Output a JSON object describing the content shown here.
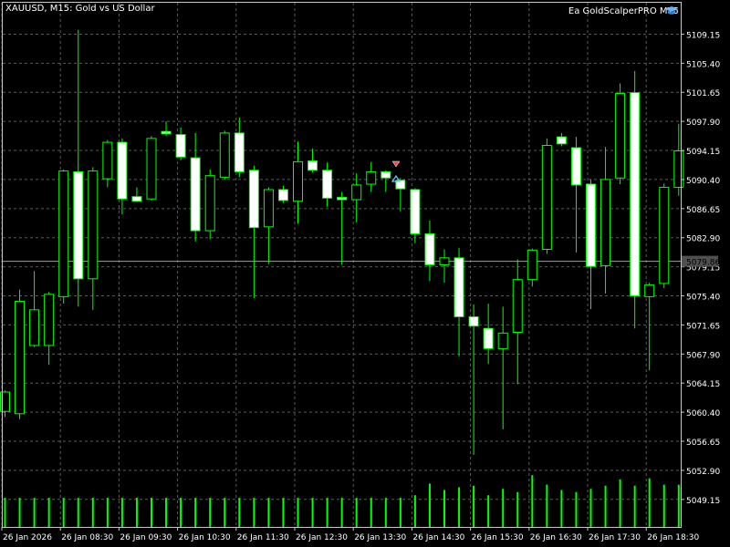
{
  "window": {
    "title": "XAUUSD, M15:  Gold vs US Dollar",
    "expert_advisor": "Ea GoldScalperPRO MT5",
    "expert_advisor_icon": "graduation-cap-icon"
  },
  "colors": {
    "background": "#000000",
    "grid": "#5a5a5a",
    "frame": "#c8c8c8",
    "bull_body": "#000000",
    "bear_body": "#ffffff",
    "candle_outline": "#00ff00",
    "wick": "#00ff00",
    "volume": "#00ff00",
    "text": "#ffffff",
    "price_line": "#a0a0a0",
    "sell_marker": "#ff4444",
    "buy_marker": "#66ccff"
  },
  "chart_data": {
    "type": "candlestick",
    "symbol": "XAUUSD",
    "timeframe": "M15",
    "current_price": 5079.86,
    "y_ticks": [
      5109.15,
      5105.4,
      5101.65,
      5097.9,
      5094.15,
      5090.4,
      5086.65,
      5082.9,
      5079.15,
      5075.4,
      5071.65,
      5067.9,
      5064.15,
      5060.4,
      5056.65,
      5052.9,
      5049.15
    ],
    "x_ticks": [
      "26 Jan 2026",
      "26 Jan 08:30",
      "26 Jan 09:30",
      "26 Jan 10:30",
      "26 Jan 11:30",
      "26 Jan 12:30",
      "26 Jan 13:30",
      "26 Jan 14:30",
      "26 Jan 15:30",
      "26 Jan 16:30",
      "26 Jan 17:30",
      "26 Jan 18:30"
    ],
    "ylim": [
      5045.6,
      5113.2
    ],
    "grid": true,
    "candles": [
      {
        "o": 5060.5,
        "h": 5063.2,
        "l": 5059.8,
        "c": 5063.0
      },
      {
        "o": 5060.2,
        "h": 5076.2,
        "l": 5059.5,
        "c": 5074.7
      },
      {
        "o": 5069.0,
        "h": 5078.6,
        "l": 5068.8,
        "c": 5073.6
      },
      {
        "o": 5069.0,
        "h": 5075.9,
        "l": 5066.5,
        "c": 5075.6
      },
      {
        "o": 5075.3,
        "h": 5091.7,
        "l": 5074.4,
        "c": 5091.5
      },
      {
        "o": 5091.4,
        "h": 5109.7,
        "l": 5074.0,
        "c": 5077.6
      },
      {
        "o": 5077.6,
        "h": 5092.0,
        "l": 5073.6,
        "c": 5091.5
      },
      {
        "o": 5090.5,
        "h": 5095.5,
        "l": 5089.4,
        "c": 5095.2
      },
      {
        "o": 5095.2,
        "h": 5095.7,
        "l": 5085.9,
        "c": 5087.9
      },
      {
        "o": 5088.2,
        "h": 5089.4,
        "l": 5087.5,
        "c": 5087.6
      },
      {
        "o": 5087.9,
        "h": 5096.0,
        "l": 5087.7,
        "c": 5095.7
      },
      {
        "o": 5096.6,
        "h": 5097.9,
        "l": 5096.0,
        "c": 5096.3
      },
      {
        "o": 5096.2,
        "h": 5097.1,
        "l": 5092.9,
        "c": 5093.3
      },
      {
        "o": 5093.2,
        "h": 5096.4,
        "l": 5082.4,
        "c": 5083.8
      },
      {
        "o": 5083.8,
        "h": 5091.7,
        "l": 5082.7,
        "c": 5090.9
      },
      {
        "o": 5090.7,
        "h": 5096.7,
        "l": 5090.4,
        "c": 5096.4
      },
      {
        "o": 5096.4,
        "h": 5098.4,
        "l": 5090.7,
        "c": 5091.4
      },
      {
        "o": 5091.6,
        "h": 5092.2,
        "l": 5075.1,
        "c": 5084.2
      },
      {
        "o": 5084.3,
        "h": 5089.4,
        "l": 5079.5,
        "c": 5089.1
      },
      {
        "o": 5089.1,
        "h": 5089.6,
        "l": 5087.4,
        "c": 5087.7
      },
      {
        "o": 5087.6,
        "h": 5095.3,
        "l": 5084.7,
        "c": 5092.7
      },
      {
        "o": 5092.8,
        "h": 5094.4,
        "l": 5091.3,
        "c": 5091.6
      },
      {
        "o": 5091.6,
        "h": 5092.6,
        "l": 5086.9,
        "c": 5088.0
      },
      {
        "o": 5088.1,
        "h": 5088.8,
        "l": 5079.4,
        "c": 5087.8
      },
      {
        "o": 5087.8,
        "h": 5091.2,
        "l": 5084.9,
        "c": 5089.7
      },
      {
        "o": 5089.8,
        "h": 5092.7,
        "l": 5088.8,
        "c": 5091.4
      },
      {
        "o": 5091.4,
        "h": 5091.6,
        "l": 5088.8,
        "c": 5090.6
      },
      {
        "o": 5090.3,
        "h": 5090.6,
        "l": 5086.3,
        "c": 5089.2
      },
      {
        "o": 5089.1,
        "h": 5089.3,
        "l": 5082.2,
        "c": 5083.4
      },
      {
        "o": 5083.4,
        "h": 5085.1,
        "l": 5077.3,
        "c": 5079.4
      },
      {
        "o": 5079.4,
        "h": 5081.4,
        "l": 5077.1,
        "c": 5080.3
      },
      {
        "o": 5080.3,
        "h": 5081.6,
        "l": 5067.6,
        "c": 5072.7
      },
      {
        "o": 5072.7,
        "h": 5074.3,
        "l": 5054.9,
        "c": 5071.5
      },
      {
        "o": 5071.2,
        "h": 5074.4,
        "l": 5066.6,
        "c": 5068.6
      },
      {
        "o": 5068.6,
        "h": 5074.0,
        "l": 5058.2,
        "c": 5070.6
      },
      {
        "o": 5070.7,
        "h": 5080.1,
        "l": 5064.0,
        "c": 5077.5
      },
      {
        "o": 5077.5,
        "h": 5081.5,
        "l": 5076.6,
        "c": 5081.3
      },
      {
        "o": 5081.4,
        "h": 5095.7,
        "l": 5080.8,
        "c": 5094.8
      },
      {
        "o": 5095.9,
        "h": 5096.4,
        "l": 5094.7,
        "c": 5095.0
      },
      {
        "o": 5094.5,
        "h": 5095.9,
        "l": 5081.0,
        "c": 5089.7
      },
      {
        "o": 5089.8,
        "h": 5090.4,
        "l": 5073.7,
        "c": 5079.2
      },
      {
        "o": 5079.3,
        "h": 5094.6,
        "l": 5075.7,
        "c": 5090.4
      },
      {
        "o": 5090.6,
        "h": 5102.8,
        "l": 5089.8,
        "c": 5101.5
      },
      {
        "o": 5101.6,
        "h": 5104.4,
        "l": 5071.2,
        "c": 5075.4
      },
      {
        "o": 5075.3,
        "h": 5077.1,
        "l": 5065.8,
        "c": 5076.8
      },
      {
        "o": 5077.0,
        "h": 5089.9,
        "l": 5076.4,
        "c": 5089.4
      },
      {
        "o": 5089.4,
        "h": 5097.6,
        "l": 5088.3,
        "c": 5094.1
      }
    ],
    "volumes": [
      0.55,
      0.55,
      0.55,
      0.55,
      0.55,
      0.55,
      0.55,
      0.55,
      0.55,
      0.55,
      0.55,
      0.55,
      0.55,
      0.55,
      0.55,
      0.55,
      0.55,
      0.55,
      0.55,
      0.55,
      0.55,
      0.55,
      0.55,
      0.55,
      0.55,
      0.55,
      0.55,
      0.55,
      0.6,
      0.82,
      0.7,
      0.75,
      0.78,
      0.6,
      0.72,
      0.66,
      0.98,
      0.8,
      0.7,
      0.66,
      0.72,
      0.78,
      0.9,
      0.78,
      0.92,
      0.8,
      0.8
    ]
  }
}
